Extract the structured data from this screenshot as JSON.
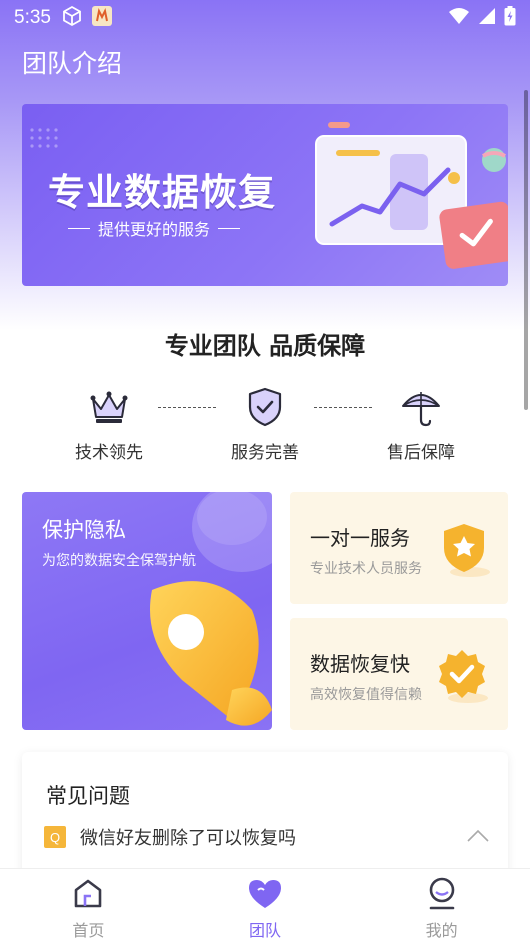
{
  "status_bar": {
    "time": "5:35"
  },
  "header": {
    "title": "团队介绍"
  },
  "banner": {
    "title": "专业数据恢复",
    "subtitle": "提供更好的服务"
  },
  "section": {
    "title": "专业团队 品质保障"
  },
  "features": [
    {
      "label": "技术领先",
      "icon": "crown-icon"
    },
    {
      "label": "服务完善",
      "icon": "shield-check-icon"
    },
    {
      "label": "售后保障",
      "icon": "umbrella-icon"
    }
  ],
  "privacy_card": {
    "title": "保护隐私",
    "subtitle": "为您的数据安全保驾护航"
  },
  "side_cards": [
    {
      "title": "一对一服务",
      "subtitle": "专业技术人员服务",
      "icon": "star-shield-icon"
    },
    {
      "title": "数据恢复快",
      "subtitle": "高效恢复值得信赖",
      "icon": "check-badge-icon"
    }
  ],
  "faq": {
    "title": "常见问题",
    "items": [
      {
        "badge": "Q",
        "question": "微信好友删除了可以恢复吗"
      }
    ]
  },
  "bottom_nav": [
    {
      "label": "首页",
      "icon": "home-icon",
      "active": false
    },
    {
      "label": "团队",
      "icon": "heart-icon",
      "active": true
    },
    {
      "label": "我的",
      "icon": "profile-icon",
      "active": false
    }
  ],
  "colors": {
    "accent": "#7f66f2",
    "badge_yellow": "#f5b63a",
    "card_cream": "#fdf6e6",
    "nav_inactive": "#9a9a9a"
  }
}
